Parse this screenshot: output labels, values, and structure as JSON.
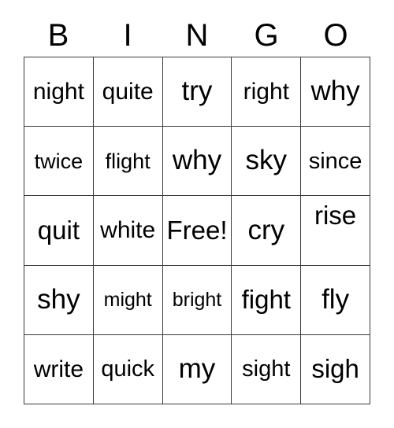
{
  "card": {
    "title": "BINGO",
    "free_space_label": "Free!",
    "columns": 5,
    "rows": 5,
    "grid_color": "#3a3a3a",
    "background_color": "#ffffff",
    "text_color": "#000000"
  },
  "header": {
    "letters": [
      "B",
      "I",
      "N",
      "G",
      "O"
    ]
  },
  "grid": {
    "rows": [
      {
        "cells": [
          {
            "text": "night",
            "size": "fs-md",
            "align": ""
          },
          {
            "text": "quite",
            "size": "fs-md",
            "align": ""
          },
          {
            "text": "try",
            "size": "fs-xl",
            "align": ""
          },
          {
            "text": "right",
            "size": "fs-md",
            "align": ""
          },
          {
            "text": "why",
            "size": "fs-xl",
            "align": ""
          }
        ]
      },
      {
        "cells": [
          {
            "text": "twice",
            "size": "fs-xs",
            "align": ""
          },
          {
            "text": "flight",
            "size": "fs-xs",
            "align": ""
          },
          {
            "text": "why",
            "size": "fs-xl",
            "align": ""
          },
          {
            "text": "sky",
            "size": "fs-xl",
            "align": ""
          },
          {
            "text": "since",
            "size": "fs-sm",
            "align": ""
          }
        ]
      },
      {
        "cells": [
          {
            "text": "quit",
            "size": "fs-lg",
            "align": ""
          },
          {
            "text": "white",
            "size": "fs-md",
            "align": ""
          },
          {
            "text": "Free!",
            "size": "fs-lg",
            "align": ""
          },
          {
            "text": "cry",
            "size": "fs-xl",
            "align": ""
          },
          {
            "text": "rise",
            "size": "fs-lg",
            "align": "align-top"
          }
        ]
      },
      {
        "cells": [
          {
            "text": "shy",
            "size": "fs-xl",
            "align": ""
          },
          {
            "text": "might",
            "size": "fs-xxs",
            "align": ""
          },
          {
            "text": "bright",
            "size": "fs-xxs",
            "align": ""
          },
          {
            "text": "fight",
            "size": "fs-lg",
            "align": ""
          },
          {
            "text": "fly",
            "size": "fs-xl",
            "align": ""
          }
        ]
      },
      {
        "cells": [
          {
            "text": "write",
            "size": "fs-md",
            "align": ""
          },
          {
            "text": "quick",
            "size": "fs-sm",
            "align": ""
          },
          {
            "text": "my",
            "size": "fs-xl",
            "align": ""
          },
          {
            "text": "sight",
            "size": "fs-sm",
            "align": ""
          },
          {
            "text": "sigh",
            "size": "fs-lg",
            "align": ""
          }
        ]
      }
    ]
  }
}
